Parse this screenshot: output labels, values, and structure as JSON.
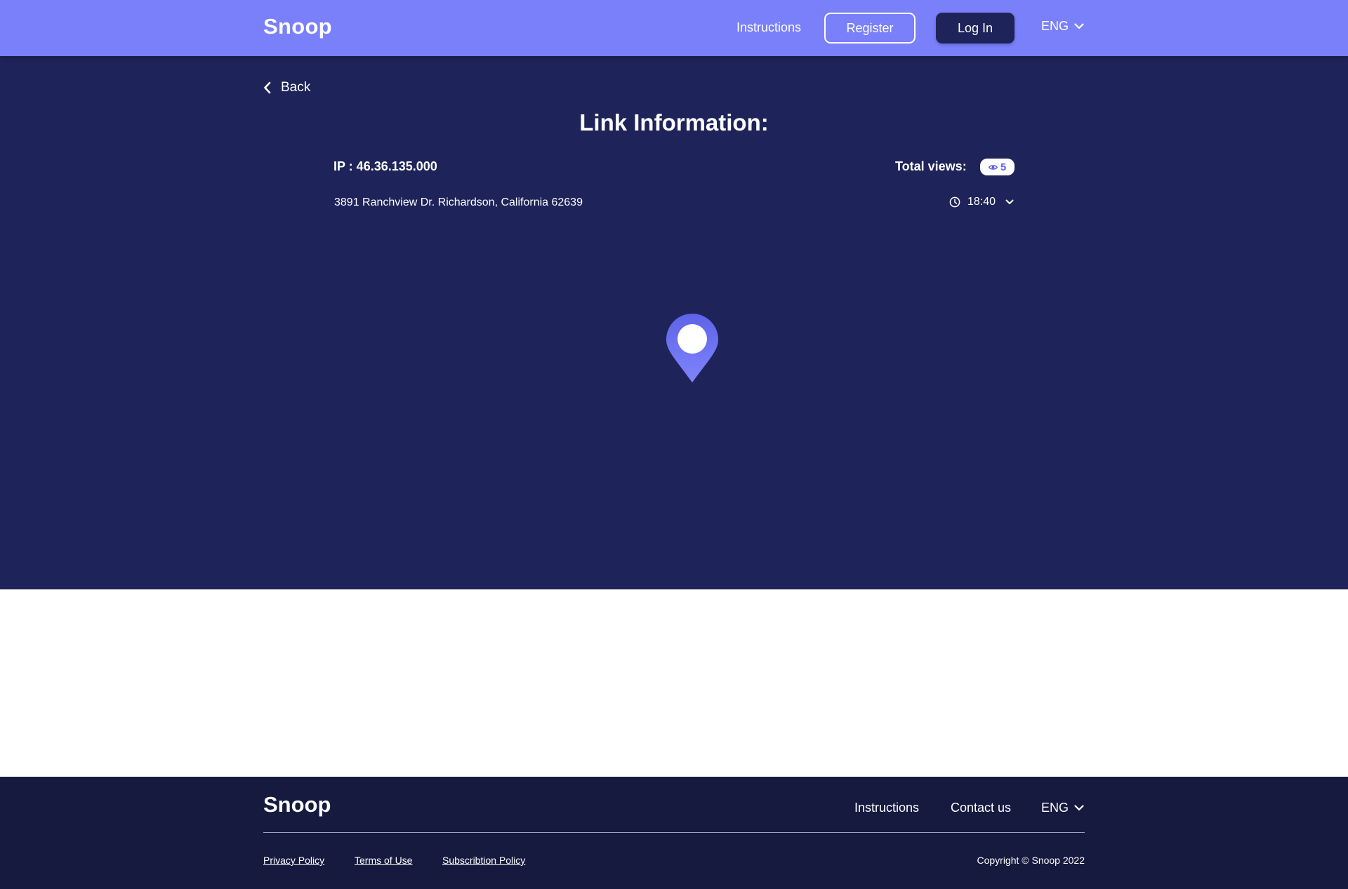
{
  "header": {
    "logo": "Snoop",
    "instructions": "Instructions",
    "register": "Register",
    "login": "Log In",
    "language": "ENG"
  },
  "main": {
    "back": "Back",
    "title": "Link Information:",
    "ip": "IP : 46.36.135.000",
    "total_views_label": "Total views:",
    "total_views_count": "5",
    "address": "3891 Ranchview Dr. Richardson, California 62639",
    "time": "18:40"
  },
  "footer": {
    "logo": "Snoop",
    "instructions": "Instructions",
    "contact": "Contact us",
    "language": "ENG",
    "privacy": "Privacy Policy",
    "terms": "Terms of Use",
    "subscription": "Subscribtion Policy",
    "copyright": "Copyright © Snoop 2022"
  },
  "colors": {
    "header_bg": "#7a7ffa",
    "main_bg": "#1e2459",
    "footer_bg": "#161a3f",
    "accent": "#5a60e6"
  },
  "icons": [
    "chevron-down-icon",
    "chevron-left-icon",
    "eye-icon",
    "clock-icon",
    "map-pin-icon"
  ]
}
